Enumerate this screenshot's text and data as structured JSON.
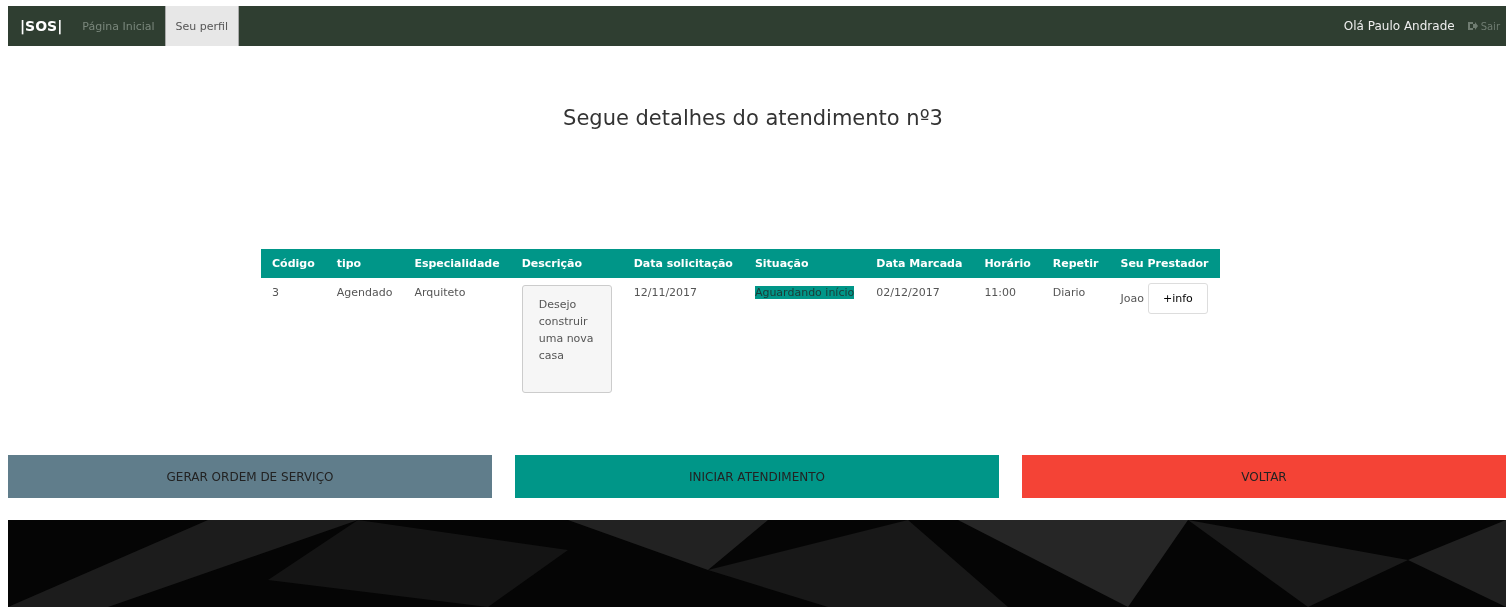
{
  "navbar": {
    "brand": "|SOS|",
    "tabs": [
      {
        "label": "Página Inicial",
        "selected": false
      },
      {
        "label": "Seu perfil",
        "selected": true
      }
    ],
    "greeting": "Olá Paulo Andrade",
    "logout": "Sair"
  },
  "title": "Segue detalhes do atendimento nº3",
  "table": {
    "columns": [
      "Código",
      "tipo",
      "Especialidade",
      "Descrição",
      "Data solicitação",
      "Situação",
      "Data Marcada",
      "Horário",
      "Repetir",
      "Seu Prestador"
    ],
    "rows": [
      {
        "cells": [
          "3",
          "Agendado",
          "Arquiteto",
          "Desejo construir uma nova casa",
          "12/11/2017",
          "Aguardando início",
          "02/12/2017",
          "11:00",
          "Diario",
          "Joao"
        ],
        "action": "+info"
      }
    ]
  },
  "buttons": [
    {
      "label": "GERAR ORDEM DE SERVIÇO",
      "kind": "secondary"
    },
    {
      "label": "INICIAR ATENDIMENTO",
      "kind": "primary"
    },
    {
      "label": "VOLTAR",
      "kind": "danger"
    }
  ]
}
